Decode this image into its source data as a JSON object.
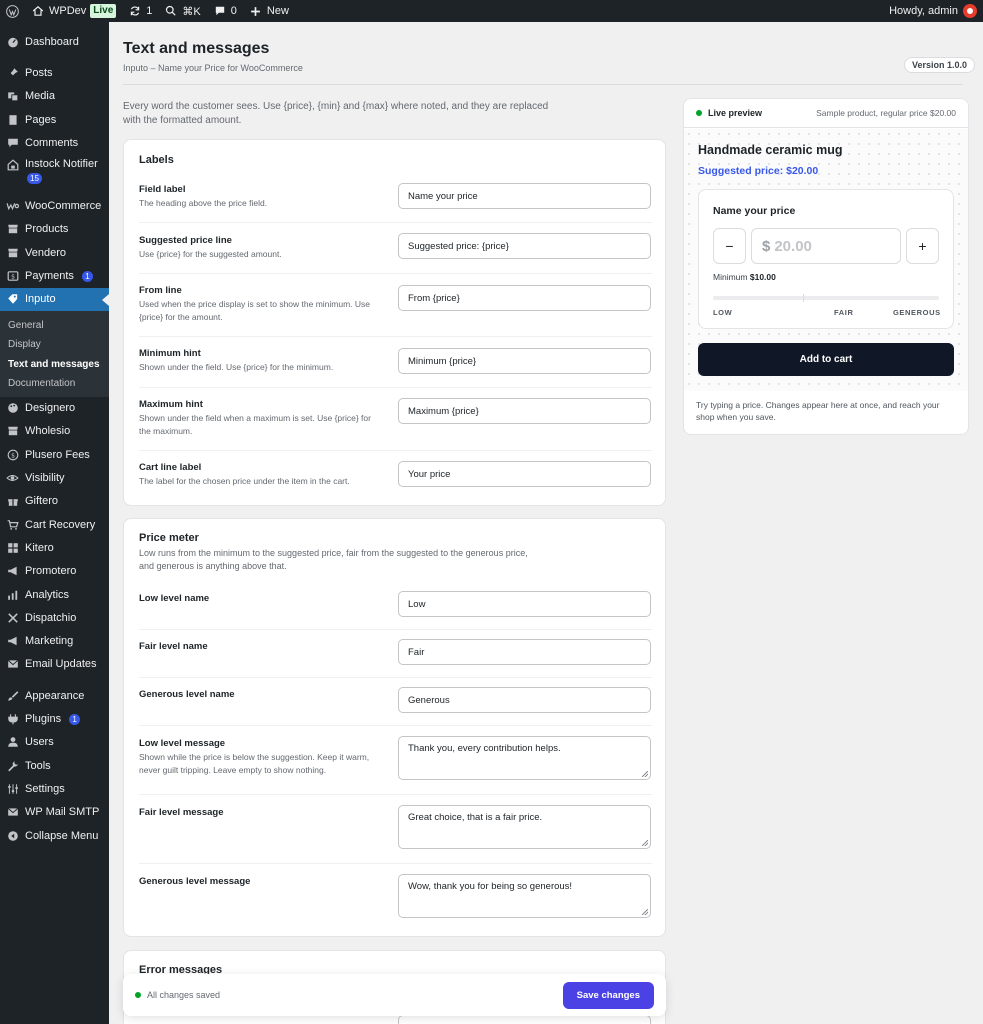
{
  "adminbar": {
    "site_name": "WPDev",
    "live_label": "Live",
    "updates_count": "1",
    "shortcut": "⌘K",
    "comments_count": "0",
    "new_label": "New",
    "greeting": "Howdy, admin"
  },
  "sidebar": {
    "items": [
      {
        "label": "Dashboard",
        "icon": "dashboard-icon"
      },
      {
        "label": "Posts",
        "icon": "pin-icon"
      },
      {
        "label": "Media",
        "icon": "media-icon"
      },
      {
        "label": "Pages",
        "icon": "page-icon"
      },
      {
        "label": "Comments",
        "icon": "comment-icon"
      },
      {
        "label": "Instock Notifier",
        "icon": "notifier-icon",
        "badge": "15"
      },
      {
        "label": "WooCommerce",
        "icon": "woo-icon"
      },
      {
        "label": "Products",
        "icon": "products-icon"
      },
      {
        "label": "Vendero",
        "icon": "store-icon"
      },
      {
        "label": "Payments",
        "icon": "payments-icon",
        "badge": "1"
      },
      {
        "label": "Inputo",
        "icon": "tag-icon"
      },
      {
        "label": "Designero",
        "icon": "palette-icon"
      },
      {
        "label": "Wholesio",
        "icon": "store-icon"
      },
      {
        "label": "Plusero Fees",
        "icon": "dollar-icon"
      },
      {
        "label": "Visibility",
        "icon": "eye-icon"
      },
      {
        "label": "Giftero",
        "icon": "gift-icon"
      },
      {
        "label": "Cart Recovery",
        "icon": "cart-icon"
      },
      {
        "label": "Kitero",
        "icon": "grid-icon"
      },
      {
        "label": "Promotero",
        "icon": "megaphone-icon"
      },
      {
        "label": "Analytics",
        "icon": "analytics-icon"
      },
      {
        "label": "Dispatchio",
        "icon": "dispatch-icon"
      },
      {
        "label": "Marketing",
        "icon": "marketing-icon"
      },
      {
        "label": "Email Updates",
        "icon": "email-icon"
      },
      {
        "label": "Appearance",
        "icon": "brush-icon"
      },
      {
        "label": "Plugins",
        "icon": "plugin-icon",
        "badge": "1"
      },
      {
        "label": "Users",
        "icon": "user-icon"
      },
      {
        "label": "Tools",
        "icon": "wrench-icon"
      },
      {
        "label": "Settings",
        "icon": "settings-icon"
      },
      {
        "label": "WP Mail SMTP",
        "icon": "mail-icon"
      },
      {
        "label": "Collapse Menu",
        "icon": "collapse-icon"
      }
    ],
    "submenu": [
      "General",
      "Display",
      "Text and messages",
      "Documentation"
    ]
  },
  "page": {
    "title": "Text and messages",
    "subtitle": "Inputo – Name your Price for WooCommerce",
    "version": "Version 1.0.0",
    "intro": "Every word the customer sees. Use {price}, {min} and {max} where noted, and they are replaced with the formatted amount."
  },
  "labels_card": {
    "title": "Labels",
    "fields": [
      {
        "label": "Field label",
        "help": "The heading above the price field.",
        "value": "Name your price"
      },
      {
        "label": "Suggested price line",
        "help": "Use {price} for the suggested amount.",
        "value": "Suggested price: {price}"
      },
      {
        "label": "From line",
        "help": "Used when the price display is set to show the minimum. Use {price} for the amount.",
        "value": "From {price}"
      },
      {
        "label": "Minimum hint",
        "help": "Shown under the field. Use {price} for the minimum.",
        "value": "Minimum {price}"
      },
      {
        "label": "Maximum hint",
        "help": "Shown under the field when a maximum is set. Use {price} for the maximum.",
        "value": "Maximum {price}"
      },
      {
        "label": "Cart line label",
        "help": "The label for the chosen price under the item in the cart.",
        "value": "Your price"
      }
    ]
  },
  "meter_card": {
    "title": "Price meter",
    "description": "Low runs from the minimum to the suggested price, fair from the suggested to the generous price, and generous is anything above that.",
    "fields": [
      {
        "label": "Low level name",
        "help": "",
        "value": "Low"
      },
      {
        "label": "Fair level name",
        "help": "",
        "value": "Fair"
      },
      {
        "label": "Generous level name",
        "help": "",
        "value": "Generous"
      },
      {
        "label": "Low level message",
        "help": "Shown while the price is below the suggestion. Keep it warm, never guilt tripping. Leave empty to show nothing.",
        "value": "Thank you, every contribution helps."
      },
      {
        "label": "Fair level message",
        "help": "",
        "value": "Great choice, that is a fair price."
      },
      {
        "label": "Generous level message",
        "help": "",
        "value": "Wow, thank you for being so generous!"
      }
    ]
  },
  "errors_card": {
    "title": "Error messages"
  },
  "preview": {
    "live_label": "Live preview",
    "sample": "Sample product, regular price $20.00",
    "product_name": "Handmade ceramic mug",
    "suggested": "Suggested price: $20.00",
    "field_label": "Name your price",
    "minus": "−",
    "plus": "+",
    "currency": "$",
    "amount_placeholder": "20.00",
    "min_label": "Minimum",
    "min_value": "$10.00",
    "levels": [
      "LOW",
      "FAIR",
      "GENEROUS"
    ],
    "cart_button": "Add to cart",
    "note": "Try typing a price. Changes appear here at once, and reach your shop when you save."
  },
  "savebar": {
    "status": "All changes saved",
    "button": "Save changes"
  },
  "colors": {
    "admin_dark": "#1d2327",
    "active_blue": "#2271b1",
    "accent_indigo": "#4b42e6",
    "suggested_blue": "#3858e9",
    "cart_dark": "#101828",
    "status_green": "#00a32a"
  }
}
